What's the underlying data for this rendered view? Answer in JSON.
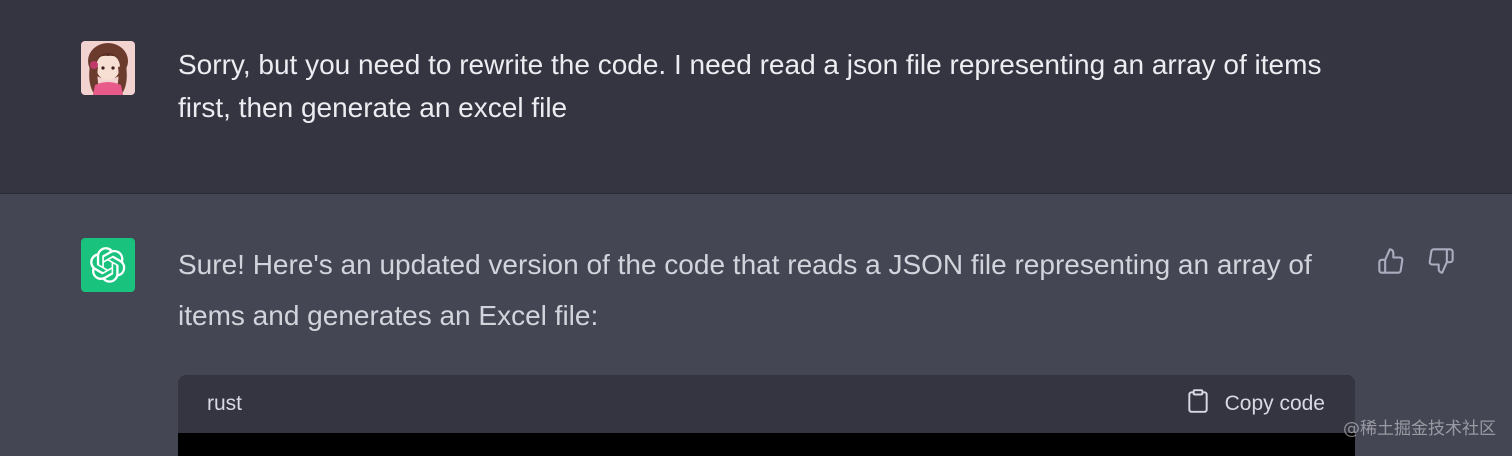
{
  "conversation": {
    "user_message": {
      "text": "Sorry, but you need to rewrite the code. I need read a json file representing an array of items first, then generate an excel file"
    },
    "assistant_message": {
      "text": "Sure! Here's an updated version of the code that reads a JSON file representing an array of items and generates an Excel file:",
      "code_block": {
        "language": "rust",
        "copy_label": "Copy code"
      },
      "feedback_icons": [
        "thumbs-up-icon",
        "thumbs-down-icon"
      ]
    }
  },
  "watermark": "@稀土掘金技术社区",
  "colors": {
    "user_bg": "#343541",
    "assistant_bg": "#444654",
    "bot_avatar": "#19c37d",
    "code_header": "#343541",
    "code_body": "#000000"
  }
}
